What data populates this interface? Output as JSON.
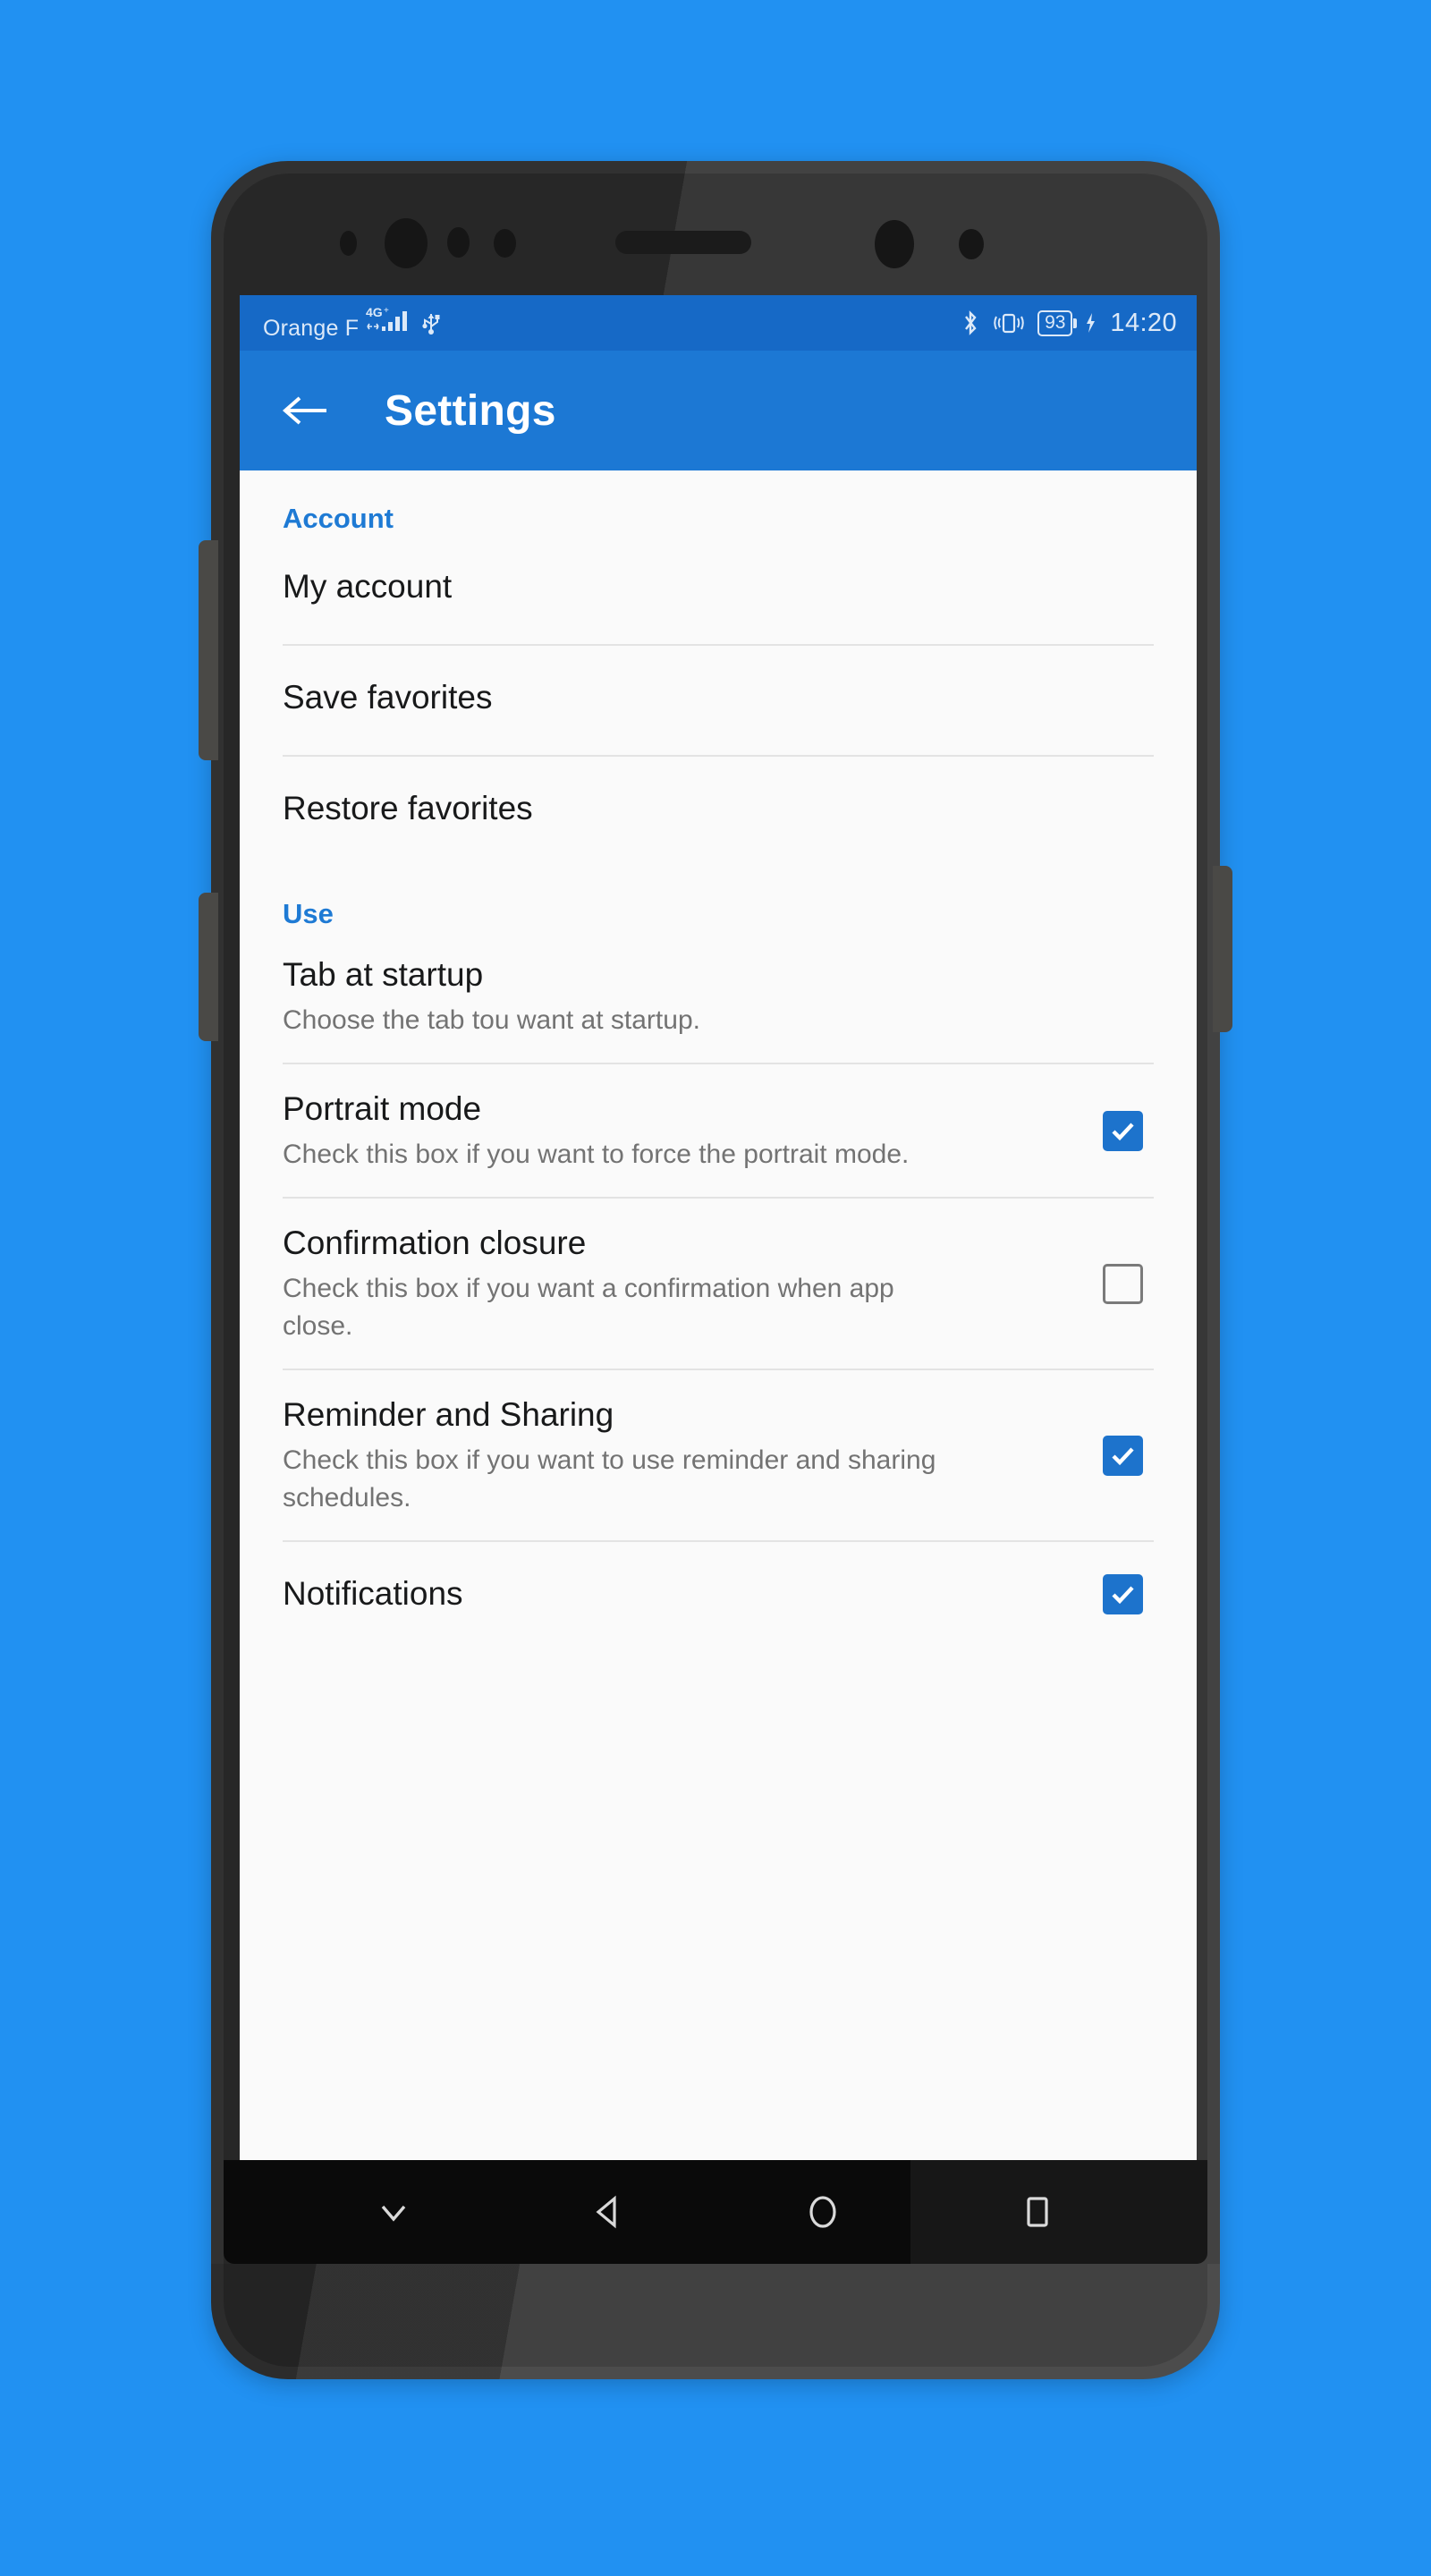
{
  "theme": {
    "wallpaper": "#2191f2",
    "status_bar_bg": "#1669c6",
    "toolbar_bg": "#1c78d4",
    "accent": "#1e7ad4",
    "checkbox_checked": "#1d73cc",
    "checkbox_unchecked_border": "#7a7a7a",
    "list_bg": "#fafafa",
    "title_color": "#18191a",
    "subtitle_color": "#737373"
  },
  "status_bar": {
    "carrier": "Orange F",
    "network_type": "4G+",
    "icons": [
      "signal-icon",
      "usb-icon",
      "bluetooth-icon",
      "vibrate-icon"
    ],
    "battery_level": "93",
    "charging": true,
    "clock": "14:20"
  },
  "toolbar": {
    "back_icon": "back-arrow-icon",
    "title": "Settings"
  },
  "sections": [
    {
      "header": "Account",
      "items": [
        {
          "title": "My account",
          "subtitle": "",
          "control": "none"
        },
        {
          "title": "Save favorites",
          "subtitle": "",
          "control": "none"
        },
        {
          "title": "Restore favorites",
          "subtitle": "",
          "control": "none"
        }
      ]
    },
    {
      "header": "Use",
      "items": [
        {
          "title": "Tab at startup",
          "subtitle": "Choose the tab tou want at startup.",
          "control": "none"
        },
        {
          "title": "Portrait mode",
          "subtitle": "Check this box if you want to force the portrait mode.",
          "control": "checkbox",
          "checked": true
        },
        {
          "title": "Confirmation closure",
          "subtitle": "Check this box if you want a confirmation when app close.",
          "control": "checkbox",
          "checked": false
        },
        {
          "title": "Reminder and Sharing",
          "subtitle": "Check this box if you want to use reminder and sharing schedules.",
          "control": "checkbox",
          "checked": true
        },
        {
          "title": "Notifications",
          "subtitle": "",
          "control": "checkbox",
          "checked": true
        }
      ]
    }
  ],
  "nav_bar": {
    "buttons": [
      {
        "icon": "chevron-down-icon",
        "label": "Hide keyboard"
      },
      {
        "icon": "back-triangle-icon",
        "label": "Back"
      },
      {
        "icon": "home-circle-icon",
        "label": "Home"
      },
      {
        "icon": "recents-square-icon",
        "label": "Recents"
      }
    ]
  }
}
